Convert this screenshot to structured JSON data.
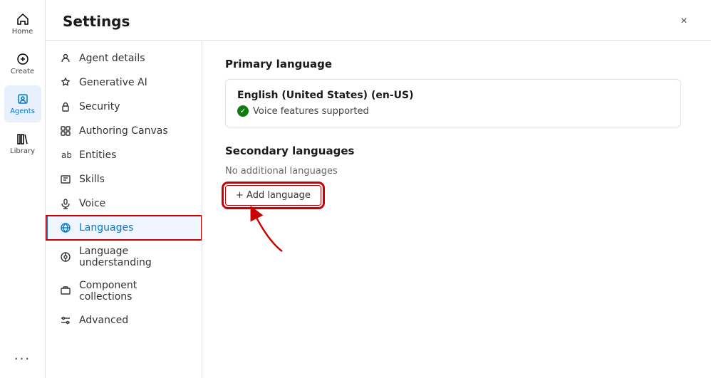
{
  "nav": {
    "items": [
      {
        "id": "home",
        "label": "Home",
        "icon": "home"
      },
      {
        "id": "create",
        "label": "Create",
        "icon": "create"
      },
      {
        "id": "agents",
        "label": "Agents",
        "icon": "agents",
        "active": true
      },
      {
        "id": "library",
        "label": "Library",
        "icon": "library"
      }
    ],
    "more_label": "..."
  },
  "settings": {
    "title": "Settings",
    "close_label": "×",
    "sidebar_items": [
      {
        "id": "agent-details",
        "label": "Agent details",
        "icon": "agent"
      },
      {
        "id": "generative-ai",
        "label": "Generative AI",
        "icon": "generative"
      },
      {
        "id": "security",
        "label": "Security",
        "icon": "security"
      },
      {
        "id": "authoring-canvas",
        "label": "Authoring Canvas",
        "icon": "canvas"
      },
      {
        "id": "entities",
        "label": "Entities",
        "icon": "entities"
      },
      {
        "id": "skills",
        "label": "Skills",
        "icon": "skills"
      },
      {
        "id": "voice",
        "label": "Voice",
        "icon": "voice"
      },
      {
        "id": "languages",
        "label": "Languages",
        "icon": "languages",
        "active": true
      },
      {
        "id": "language-understanding",
        "label": "Language understanding",
        "icon": "lang-understanding"
      },
      {
        "id": "component-collections",
        "label": "Component collections",
        "icon": "components"
      },
      {
        "id": "advanced",
        "label": "Advanced",
        "icon": "advanced"
      }
    ],
    "content": {
      "primary_language_title": "Primary language",
      "primary_language_name": "English (United States) (en-US)",
      "primary_language_support": "Voice features supported",
      "secondary_language_title": "Secondary languages",
      "no_additional_languages": "No additional languages",
      "add_language_label": "+ Add language"
    }
  }
}
